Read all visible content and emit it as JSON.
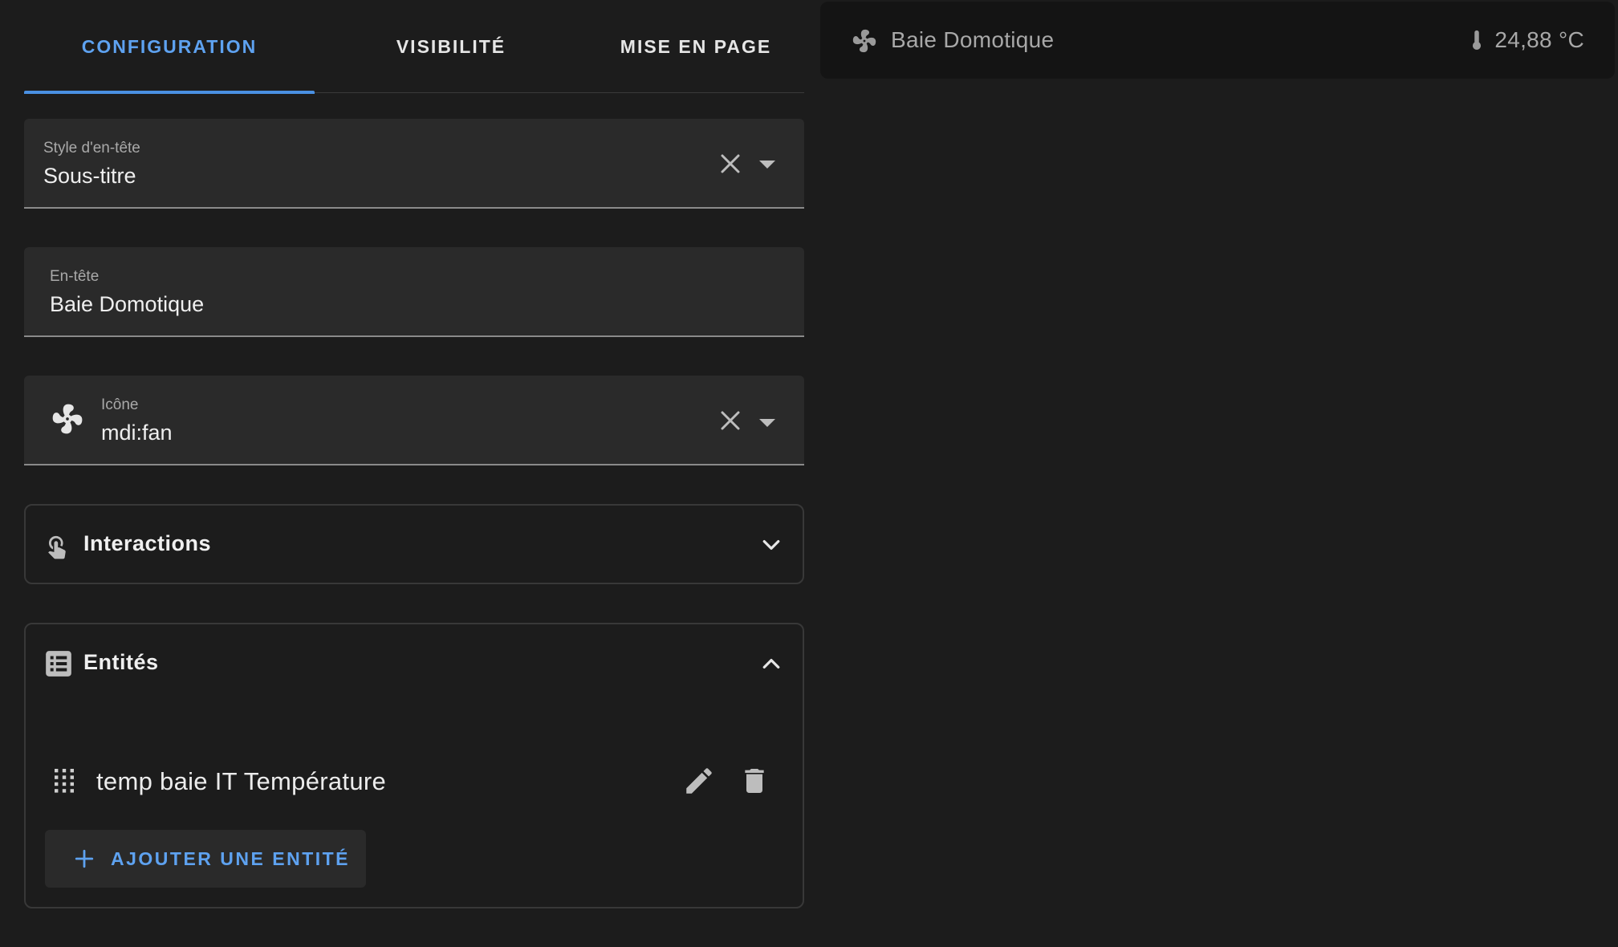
{
  "tabs": [
    {
      "label": "CONFIGURATION",
      "active": true
    },
    {
      "label": "VISIBILITÉ",
      "active": false
    },
    {
      "label": "MISE EN PAGE",
      "active": false
    }
  ],
  "header_style": {
    "label": "Style d'en-tête",
    "value": "Sous-titre"
  },
  "heading": {
    "label": "En-tête",
    "value": "Baie Domotique"
  },
  "icon_field": {
    "label": "Icône",
    "value": "mdi:fan",
    "icon": "fan-icon"
  },
  "interactions": {
    "title": "Interactions",
    "icon": "gesture-tap-icon",
    "expanded": false
  },
  "entities": {
    "title": "Entités",
    "icon": "list-box-icon",
    "expanded": true,
    "items": [
      {
        "name": "temp baie IT Température"
      }
    ],
    "add_label": "AJOUTER UNE ENTITÉ"
  },
  "preview": {
    "title": "Baie Domotique",
    "icon": "fan-icon",
    "state_icon": "thermometer-icon",
    "state": "24,88 °C"
  },
  "colors": {
    "background": "#1c1c1c",
    "accent": "#4a90e2",
    "field_bg": "#2a2a2a",
    "card_bg": "#141414"
  }
}
